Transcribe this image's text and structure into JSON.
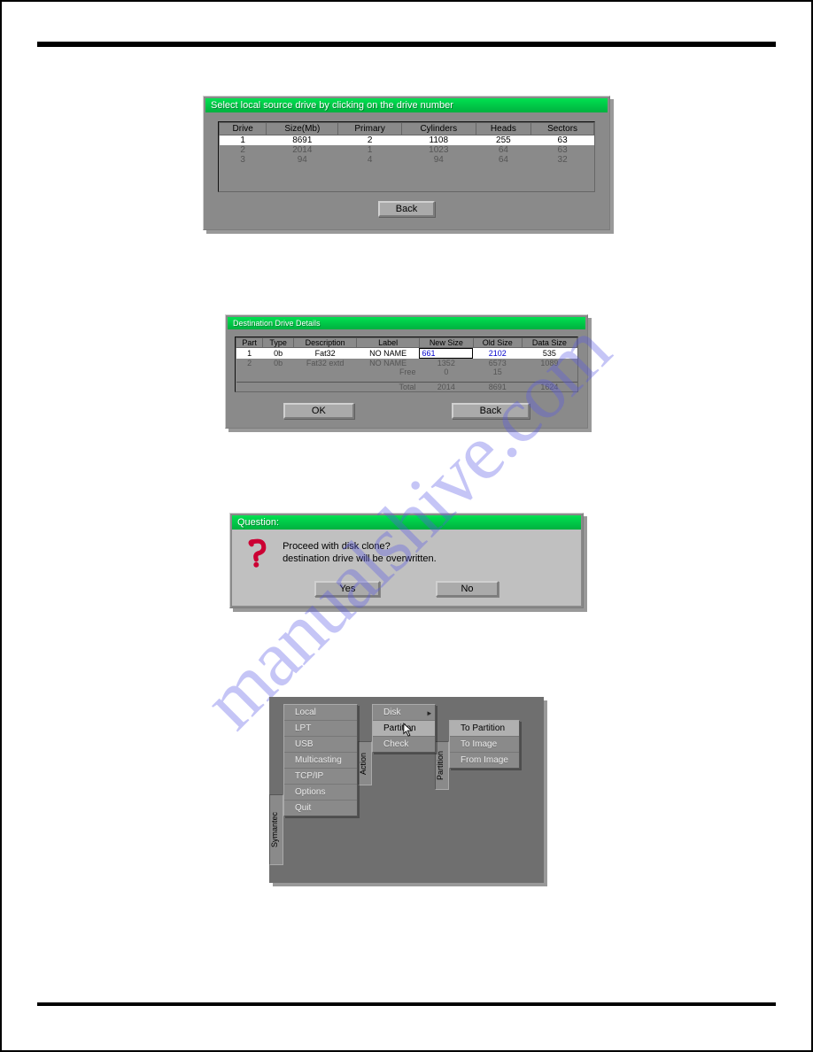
{
  "watermark": "manualshive.com",
  "dlg1": {
    "title": "Select local source drive by clicking on the drive number",
    "headers": [
      "Drive",
      "Size(Mb)",
      "Primary",
      "Cylinders",
      "Heads",
      "Sectors"
    ],
    "rows": [
      {
        "drive": "1",
        "size": "8691",
        "primary": "2",
        "cyl": "1108",
        "heads": "255",
        "sectors": "63",
        "sel": true
      },
      {
        "drive": "2",
        "size": "2014",
        "primary": "1",
        "cyl": "1023",
        "heads": "64",
        "sectors": "63",
        "sel": false
      },
      {
        "drive": "3",
        "size": "94",
        "primary": "4",
        "cyl": "94",
        "heads": "64",
        "sectors": "32",
        "sel": false
      }
    ],
    "back_label": "Back"
  },
  "dlg2": {
    "title": "Destination Drive Details",
    "headers": [
      "Part",
      "Type",
      "Description",
      "Label",
      "New Size",
      "Old Size",
      "Data Size"
    ],
    "rows": [
      {
        "part": "1",
        "type": "0b",
        "desc": "Fat32",
        "label": "NO NAME",
        "new": "661",
        "old": "2102",
        "data": "535",
        "sel": true
      },
      {
        "part": "2",
        "type": "0b",
        "desc": "Fat32 extd",
        "label": "NO NAME",
        "new": "1352",
        "old": "6573",
        "data": "1089",
        "sel": false
      }
    ],
    "free_label": "Free",
    "free_new": "0",
    "free_old": "15",
    "total_label": "Total",
    "total_new": "2014",
    "total_old": "8691",
    "total_data": "1624",
    "ok_label": "OK",
    "back_label": "Back"
  },
  "dlg3": {
    "title": "Question:",
    "line1": "Proceed with disk clone?",
    "line2": "destination drive will be overwritten.",
    "yes_label": "Yes",
    "no_label": "No"
  },
  "menu": {
    "tab_symantec": "Symantec",
    "tab_action": "Action",
    "tab_partition": "Partition",
    "col1": [
      "Local",
      "LPT",
      "USB",
      "Multicasting",
      "TCP/IP",
      "Options",
      "Quit"
    ],
    "col2": [
      "Disk",
      "Partition",
      "Check"
    ],
    "col3": [
      "To Partition",
      "To Image",
      "From Image"
    ]
  }
}
